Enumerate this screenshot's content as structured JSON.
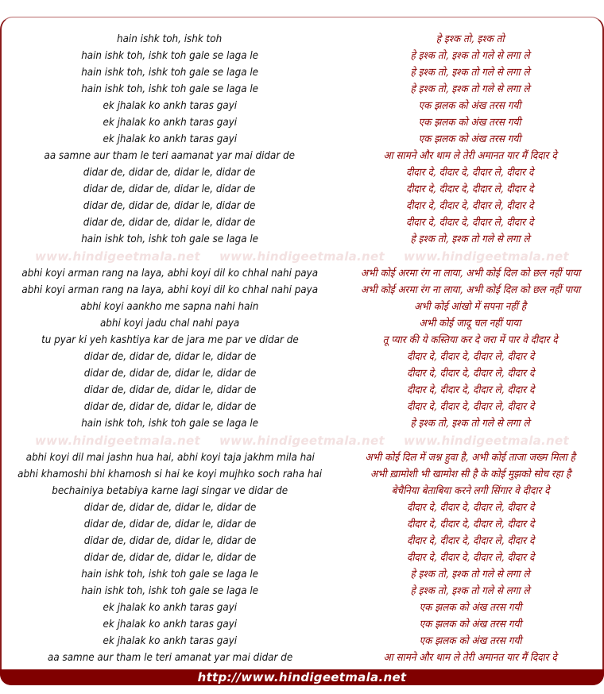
{
  "colors": {
    "accent": "#800000",
    "hindi_text": "#8b0000",
    "english_text": "#111111",
    "watermark": "#f3e1e1"
  },
  "watermark_text": "www.hindigeetmala.net",
  "footer": {
    "url_label": "http://www.hindigeetmala.net"
  },
  "sections": [
    {
      "english": [
        "hain ishk toh, ishk toh",
        "hain ishk toh, ishk toh gale se laga le",
        "hain ishk toh, ishk toh gale se laga le",
        "hain ishk toh, ishk toh gale se laga le",
        "ek jhalak ko ankh taras gayi",
        "ek jhalak ko ankh taras gayi",
        "ek jhalak ko ankh taras gayi",
        "aa samne aur tham le teri aamanat yar mai didar de",
        "didar de, didar de, didar le, didar de",
        "didar de, didar de, didar le, didar de",
        "didar de, didar de, didar le, didar de",
        "didar de, didar de, didar le, didar de",
        "hain ishk toh, ishk toh gale se laga le"
      ],
      "hindi": [
        "हे इश्क तो, इश्क तो",
        "हे इश्क तो, इश्क तो गले से लगा ले",
        "हे इश्क तो, इश्क तो गले से लगा ले",
        "हे इश्क तो, इश्क तो गले से लगा ले",
        "एक झलक को अंख तरस गयी",
        "एक झलक को अंख तरस गयी",
        "एक झलक को अंख तरस गयी",
        "आ सामने और थाम ले तेरी अमानत यार मैं दिदार दे",
        "दीदार दे, दीदार दे, दीदार ले, दीदार दे",
        "दीदार दे, दीदार दे, दीदार ले, दीदार दे",
        "दीदार दे, दीदार दे, दीदार ले, दीदार दे",
        "दीदार दे, दीदार दे, दीदार ले, दीदार दे",
        "हे इश्क तो, इश्क तो गले से लगा ले"
      ]
    },
    {
      "english": [
        "abhi koyi arman rang na laya, abhi koyi dil ko chhal nahi paya",
        "abhi koyi arman rang na laya, abhi koyi dil ko chhal nahi paya",
        "abhi koyi aankho me sapna nahi hain",
        "abhi koyi jadu chal nahi paya",
        "tu pyar ki yeh kashtiya kar de jara me par ve didar de",
        "didar de, didar de, didar le, didar de",
        "didar de, didar de, didar le, didar de",
        "didar de, didar de, didar le, didar de",
        "didar de, didar de, didar le, didar de",
        "hain ishk toh, ishk toh gale se laga le"
      ],
      "hindi": [
        "अभी कोई अरमा रंग ना लाया, अभी कोई दिल को छल नहीं पाया",
        "अभी कोई अरमा रंग ना लाया, अभी कोई दिल को छल नहीं पाया",
        "अभी कोई आंखो में सपना नहीं है",
        "अभी कोई जादू चल नहीं पाया",
        "तू प्यार की ये कस्तिया कर दे जरा में पार वे दीदार दे",
        "दीदार दे, दीदार दे, दीदार ले, दीदार दे",
        "दीदार दे, दीदार दे, दीदार ले, दीदार दे",
        "दीदार दे, दीदार दे, दीदार ले, दीदार दे",
        "दीदार दे, दीदार दे, दीदार ले, दीदार दे",
        "हे इश्क तो, इश्क तो गले से लगा ले"
      ]
    },
    {
      "english": [
        "abhi koyi dil mai jashn hua hai, abhi koyi taja jakhm mila hai",
        "abhi khamoshi bhi khamosh si hai ke koyi mujhko soch raha hai",
        "bechainiya betabiya karne lagi singar ve didar de",
        "didar de, didar de, didar le, didar de",
        "didar de, didar de, didar le, didar de",
        "didar de, didar de, didar le, didar de",
        "didar de, didar de, didar le, didar de",
        "hain ishk toh, ishk toh gale se laga le",
        "hain ishk toh, ishk toh gale se laga le",
        "ek jhalak ko ankh taras gayi",
        "ek jhalak ko ankh taras gayi",
        "ek jhalak ko ankh taras gayi",
        "aa samne aur tham le teri amanat yar mai didar de"
      ],
      "hindi": [
        "अभी कोई दिल में जश्न हुवा है, अभी कोई ताजा जख्म मिला है",
        "अभी ख़ामोशी भी खामोश सी है के कोई मुझको सोच रहा है",
        "बेचैनिया बेताबिया करने लगी सिंगार वे दीदार दे",
        "दीदार दे, दीदार दे, दीदार ले, दीदार दे",
        "दीदार दे, दीदार दे, दीदार ले, दीदार दे",
        "दीदार दे, दीदार दे, दीदार ले, दीदार दे",
        "दीदार दे, दीदार दे, दीदार ले, दीदार दे",
        "हे इश्क तो, इश्क तो गले से लगा ले",
        "हे इश्क तो, इश्क तो गले से लगा ले",
        "एक झलक को अंख तरस गयी",
        "एक झलक को अंख तरस गयी",
        "एक झलक को अंख तरस गयी",
        "आ सामने और थाम ले तेरी अमानत यार मैं दिदार दे"
      ]
    }
  ]
}
